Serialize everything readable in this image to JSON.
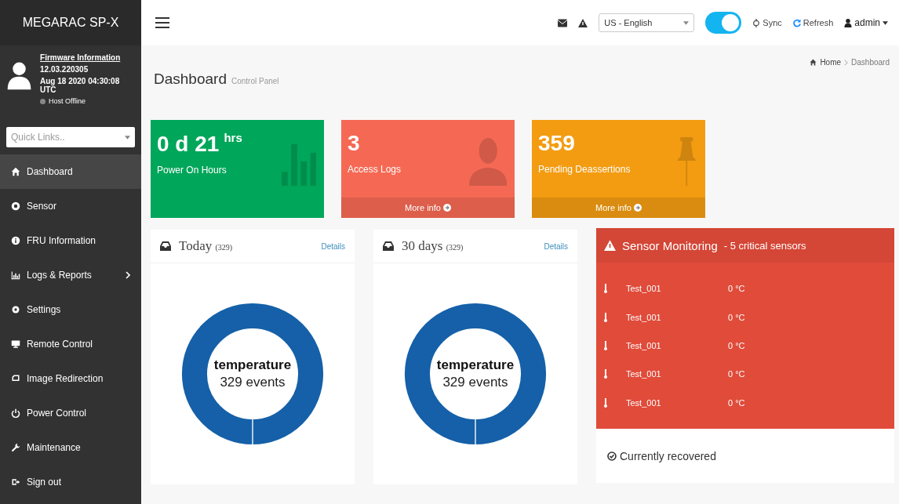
{
  "sidebar": {
    "brand": "MEGARAC SP-X",
    "firmware_link": "Firmware Information",
    "version": "12.03.220305",
    "build_date": "Aug 18 2020 04:30:08 UTC",
    "host_status": "Host Offline",
    "quick_links": {
      "placeholder": "Quick Links.."
    },
    "items": [
      {
        "label": "Dashboard",
        "selected": true,
        "has_submenu": false
      },
      {
        "label": "Sensor",
        "selected": false,
        "has_submenu": false
      },
      {
        "label": "FRU Information",
        "selected": false,
        "has_submenu": false
      },
      {
        "label": "Logs & Reports",
        "selected": false,
        "has_submenu": true
      },
      {
        "label": "Settings",
        "selected": false,
        "has_submenu": false
      },
      {
        "label": "Remote Control",
        "selected": false,
        "has_submenu": false
      },
      {
        "label": "Image Redirection",
        "selected": false,
        "has_submenu": false
      },
      {
        "label": "Power Control",
        "selected": false,
        "has_submenu": false
      },
      {
        "label": "Maintenance",
        "selected": false,
        "has_submenu": false
      },
      {
        "label": "Sign out",
        "selected": false,
        "has_submenu": false
      }
    ]
  },
  "topbar": {
    "language": "US - English",
    "toggle_on": true,
    "sync": "Sync",
    "refresh": "Refresh",
    "user": "admin"
  },
  "page": {
    "title": "Dashboard",
    "subtitle": "Control Panel",
    "breadcrumb": [
      "Home",
      "Dashboard"
    ]
  },
  "stat_cards": [
    {
      "value": "0 d 21",
      "unit": "hrs",
      "label": "Power On Hours",
      "color": "#00a65a"
    },
    {
      "value": "3",
      "label": "Access Logs",
      "color": "#f56954",
      "footer": "More info"
    },
    {
      "value": "359",
      "label": "Pending Deassertions",
      "color": "#f39c12",
      "footer": "More info"
    }
  ],
  "event_panels": [
    {
      "title": "Today",
      "count": "(329)",
      "link": "Details",
      "center_label": "temperature",
      "center_value": "329 events"
    },
    {
      "title": "30 days",
      "count": "(329)",
      "link": "Details",
      "center_label": "temperature",
      "center_value": "329 events"
    }
  ],
  "sensor_monitoring": {
    "title": "Sensor Monitoring",
    "subtitle": "- 5 critical sensors",
    "rows": [
      {
        "name": "Test_001",
        "reading": "0 °C"
      },
      {
        "name": "Test_001",
        "reading": "0 °C"
      },
      {
        "name": "Test_001",
        "reading": "0 °C"
      },
      {
        "name": "Test_001",
        "reading": "0 °C"
      },
      {
        "name": "Test_001",
        "reading": "0 °C"
      }
    ],
    "footer": "Currently recovered"
  }
}
